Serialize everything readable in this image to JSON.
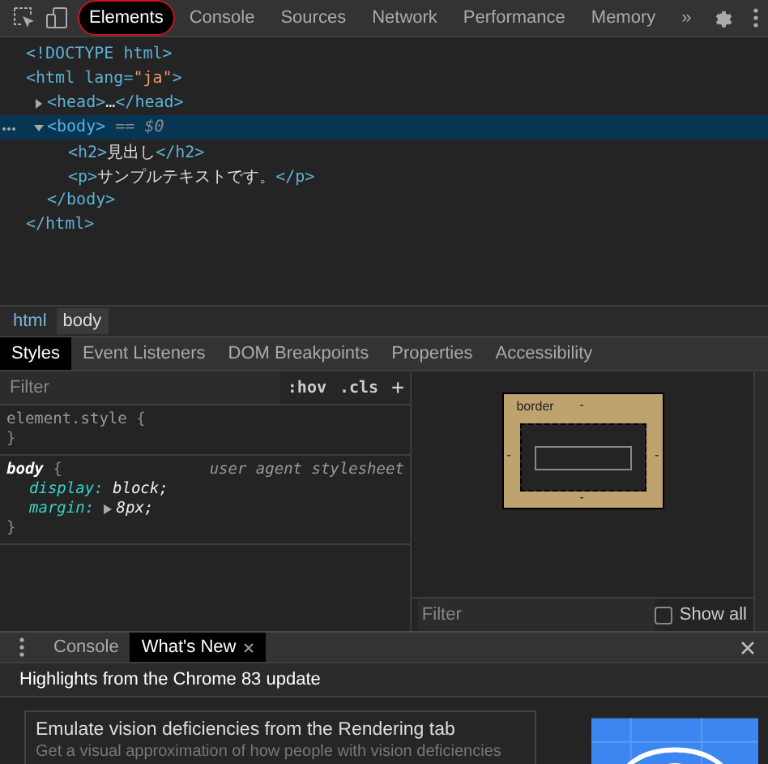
{
  "toolbar": {
    "tabs": [
      {
        "label": "Elements",
        "selected": true
      },
      {
        "label": "Console",
        "selected": false
      },
      {
        "label": "Sources",
        "selected": false
      },
      {
        "label": "Network",
        "selected": false
      },
      {
        "label": "Performance",
        "selected": false
      },
      {
        "label": "Memory",
        "selected": false
      }
    ],
    "overflow": "»"
  },
  "dom_tree": [
    {
      "kind": "leaf",
      "text": "<!DOCTYPE html>"
    },
    {
      "kind": "element",
      "open": "<html lang=\"ja\">",
      "selected": false,
      "close": "</html>",
      "children": [
        {
          "kind": "element",
          "open": "<head>…</head>",
          "expanded": false,
          "selected": false
        },
        {
          "kind": "element",
          "open": "<body>",
          "suffix": "== $0",
          "expanded": true,
          "selected": true,
          "close": "</body>",
          "children": [
            {
              "kind": "leaf",
              "text": "<h2>見出し</h2>"
            },
            {
              "kind": "leaf",
              "text": "<p>サンプルテキストです。</p>"
            }
          ]
        }
      ]
    }
  ],
  "breadcrumbs": [
    {
      "label": "html",
      "selected": false
    },
    {
      "label": "body",
      "selected": true
    }
  ],
  "sidebar_tabs": [
    {
      "label": "Styles",
      "selected": true
    },
    {
      "label": "Event Listeners",
      "selected": false
    },
    {
      "label": "DOM Breakpoints",
      "selected": false
    },
    {
      "label": "Properties",
      "selected": false
    },
    {
      "label": "Accessibility",
      "selected": false
    }
  ],
  "styles": {
    "filter_placeholder": "Filter",
    "hov": ":hov",
    "cls": ".cls",
    "add": "+",
    "rules": [
      {
        "selector": "element.style",
        "open": "{",
        "close": "}"
      },
      {
        "selector": "body",
        "open": "{",
        "source": "user agent stylesheet",
        "close": "}",
        "declarations": [
          {
            "property": "display:",
            "value": "block;",
            "expandable": false
          },
          {
            "property": "margin:",
            "value": "8px;",
            "expandable": true
          }
        ]
      }
    ]
  },
  "box_model": {
    "label": "border",
    "dash": "-"
  },
  "computed": {
    "filter_placeholder": "Filter",
    "show_all": {
      "label": "Show all",
      "checked": false
    }
  },
  "drawer": {
    "tabs": [
      {
        "label": "Console",
        "selected": false,
        "closable": false
      },
      {
        "label": "What's New",
        "selected": true,
        "closable": true
      }
    ],
    "heading": "Highlights from the Chrome 83 update",
    "card": {
      "title": "Emulate vision deficiencies from the Rendering tab",
      "description": "Get a visual approximation of how people with vision deficiencies"
    }
  }
}
